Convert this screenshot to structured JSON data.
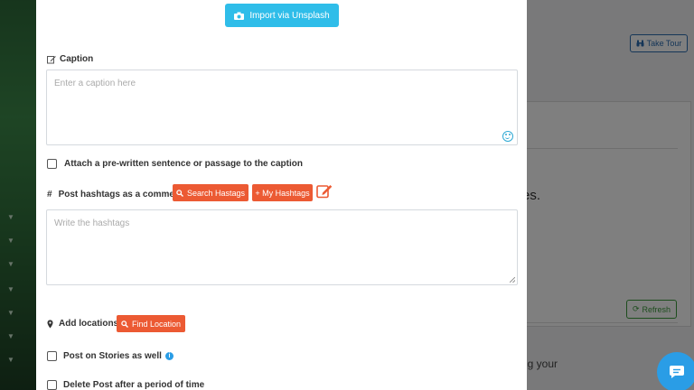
{
  "modal": {
    "unsplash_label": "Import via Unsplash",
    "caption": {
      "label": "Caption",
      "placeholder": "Enter a caption here"
    },
    "attach_label": "Attach a pre-written sentence or passage to the caption",
    "hashtags": {
      "symbol": "#",
      "label": "Post hashtags as a comment",
      "search_label": "Search Hastags",
      "my_label": "+ My Hashtags",
      "placeholder": "Write the hashtags"
    },
    "location": {
      "label": "Add locations",
      "find_label": "Find Location"
    },
    "stories_label": "Post on Stories as well",
    "delete_label": "Delete Post after a period of time"
  },
  "background": {
    "take_tour_label": "Take Tour",
    "refresh_label": "Refresh",
    "partial_text_1": "es.",
    "partial_text_2": "ng your"
  },
  "colors": {
    "accent_blue": "#2fbde9",
    "accent_orange": "#ec5a33",
    "chat_blue": "#2a9de6"
  },
  "icons": [
    "camera-icon",
    "edit-icon",
    "smiley-icon",
    "search-icon",
    "map-pin-icon",
    "info-icon",
    "refresh-icon",
    "binoculars-icon",
    "chat-icon"
  ]
}
